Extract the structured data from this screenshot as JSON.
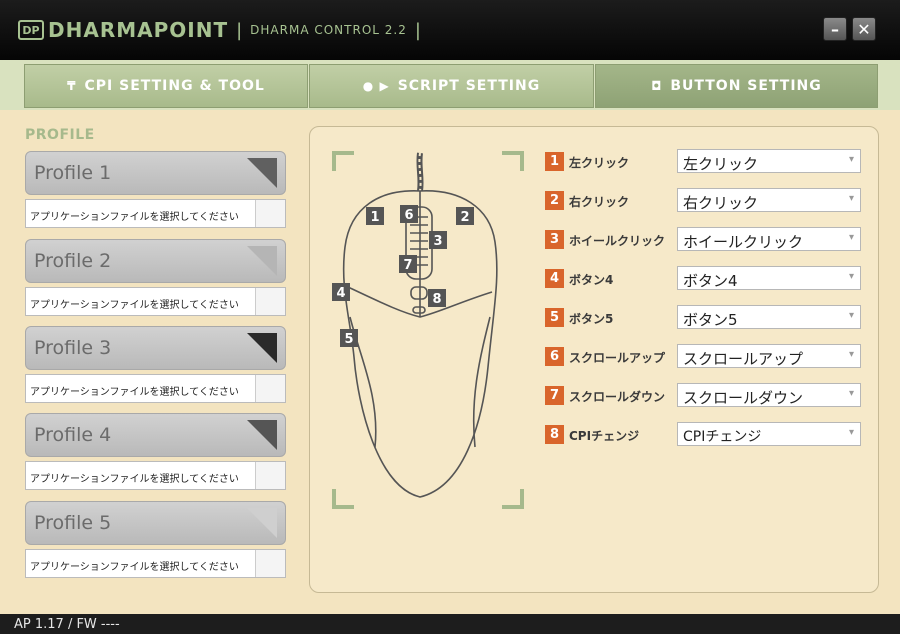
{
  "app": {
    "logo_badge": "DP",
    "logo_text": "DHARMAPOINT",
    "subtitle": "DHARMA CONTROL 2.2"
  },
  "window_controls": {
    "minimize": "–",
    "close": "✕"
  },
  "tabs": [
    {
      "label": "CPI SETTING & TOOL",
      "icon": "filter-icon",
      "glyph": "₸",
      "active": false
    },
    {
      "label": "SCRIPT SETTING",
      "icon": "record-play-icon",
      "glyph": "● ▶",
      "active": false
    },
    {
      "label": "BUTTON SETTING",
      "icon": "button-icon",
      "glyph": "◘",
      "active": true
    }
  ],
  "profiles": {
    "heading": "PROFILE",
    "items": [
      {
        "name": "Profile 1",
        "file_placeholder": "アプリケーションファイルを選択してください",
        "corner_color": "#606060"
      },
      {
        "name": "Profile 2",
        "file_placeholder": "アプリケーションファイルを選択してください",
        "corner_color": "#b5b5b5"
      },
      {
        "name": "Profile 3",
        "file_placeholder": "アプリケーションファイルを選択してください",
        "corner_color": "#2a2a2a"
      },
      {
        "name": "Profile 4",
        "file_placeholder": "アプリケーションファイルを選択してください",
        "corner_color": "#555555"
      },
      {
        "name": "Profile 5",
        "file_placeholder": "アプリケーションファイルを選択してください",
        "corner_color": "#cfcfcf"
      }
    ]
  },
  "mouse_labels": [
    "1",
    "2",
    "3",
    "4",
    "5",
    "6",
    "7",
    "8"
  ],
  "buttons": [
    {
      "num": "1",
      "label": "左クリック",
      "value": "左クリック"
    },
    {
      "num": "2",
      "label": "右クリック",
      "value": "右クリック"
    },
    {
      "num": "3",
      "label": "ホイールクリック",
      "value": "ホイールクリック"
    },
    {
      "num": "4",
      "label": "ボタン4",
      "value": "ボタン4"
    },
    {
      "num": "5",
      "label": "ボタン5",
      "value": "ボタン5"
    },
    {
      "num": "6",
      "label": "スクロールアップ",
      "value": "スクロールアップ"
    },
    {
      "num": "7",
      "label": "スクロールダウン",
      "value": "スクロールダウン"
    },
    {
      "num": "8",
      "label": "CPIチェンジ",
      "value": "CPIチェンジ"
    }
  ],
  "status": "AP 1.17 / FW ----",
  "colors": {
    "accent_green": "#a7c291",
    "badge_orange": "#d9652b",
    "background": "#f3e4c0"
  }
}
